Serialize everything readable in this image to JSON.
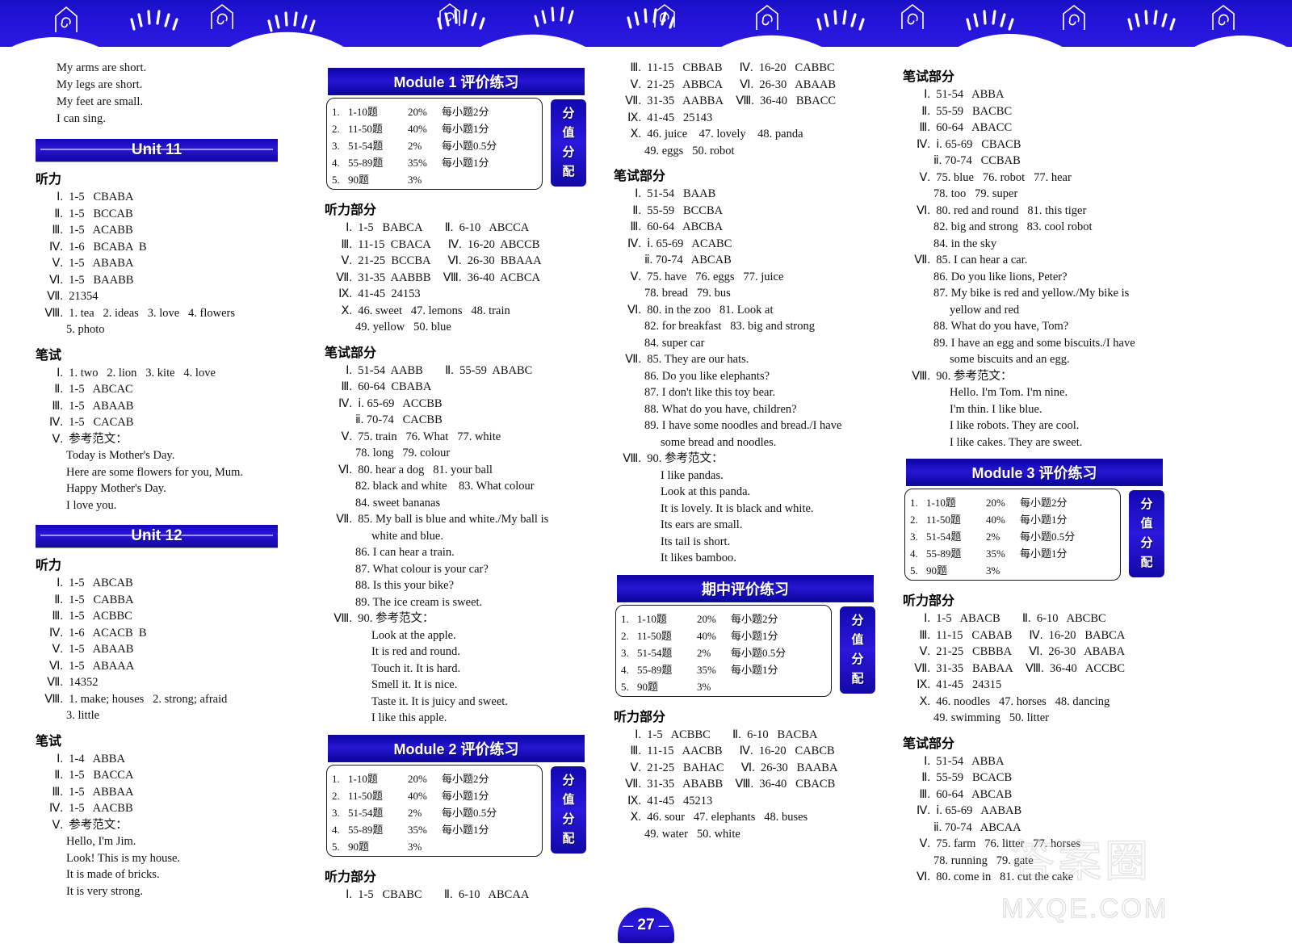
{
  "page": {
    "number": "27",
    "watermark_text": "MXQE.COM",
    "watermark_cn": "答案圈"
  },
  "score_badge_label": "分值分配",
  "score_table": {
    "rows": [
      {
        "n": "1.",
        "q": "1-10题",
        "p": "20%",
        "d": "每小题2分"
      },
      {
        "n": "2.",
        "q": "11-50题",
        "p": "40%",
        "d": "每小题1分"
      },
      {
        "n": "3.",
        "q": "51-54题",
        "p": "2%",
        "d": "每小题0.5分"
      },
      {
        "n": "4.",
        "q": "55-89题",
        "p": "35%",
        "d": "每小题1分"
      },
      {
        "n": "5.",
        "q": "90题",
        "p": "3%",
        "d": ""
      }
    ]
  },
  "headings": {
    "listening": "听力部分",
    "written": "笔试部分",
    "listening_short": "听力",
    "written_short": "笔试",
    "model_essay": "参考范文："
  },
  "column1": {
    "poem": [
      "My arms are short.",
      "My legs are short.",
      "My feet are small.",
      "I can sing."
    ],
    "unit11": {
      "title": "Unit 11",
      "listening": [
        {
          "rn": "Ⅰ.",
          "body": "1-5   CBABA"
        },
        {
          "rn": "Ⅱ.",
          "body": "1-5   BCCAB"
        },
        {
          "rn": "Ⅲ.",
          "body": "1-5   ACABB"
        },
        {
          "rn": "Ⅳ.",
          "body": "1-6   BCABA  B"
        },
        {
          "rn": "Ⅴ.",
          "body": "1-5   ABABA"
        },
        {
          "rn": "Ⅵ.",
          "body": "1-5   BAABB"
        },
        {
          "rn": "Ⅶ.",
          "body": "21354"
        },
        {
          "rn": "Ⅷ.",
          "body": "1. tea   2. ideas   3. love   4. flowers"
        },
        {
          "rn": "",
          "body": "5. photo",
          "indent": 1
        }
      ],
      "written": [
        {
          "rn": "Ⅰ.",
          "body": "1. two   2. lion   3. kite   4. love"
        },
        {
          "rn": "Ⅱ.",
          "body": "1-5   ABCAC"
        },
        {
          "rn": "Ⅲ.",
          "body": "1-5   ABAAB"
        },
        {
          "rn": "Ⅳ.",
          "body": "1-5   CACAB"
        },
        {
          "rn": "Ⅴ.",
          "body": "参考范文："
        },
        {
          "rn": "",
          "body": "Today is Mother's Day.",
          "indent": 1
        },
        {
          "rn": "",
          "body": "Here are some flowers for you, Mum.",
          "indent": 1
        },
        {
          "rn": "",
          "body": "Happy Mother's Day.",
          "indent": 1
        },
        {
          "rn": "",
          "body": "I love you.",
          "indent": 1
        }
      ]
    },
    "unit12": {
      "title": "Unit 12",
      "listening": [
        {
          "rn": "Ⅰ.",
          "body": "1-5   ABCAB"
        },
        {
          "rn": "Ⅱ.",
          "body": "1-5   CABBA"
        },
        {
          "rn": "Ⅲ.",
          "body": "1-5   ACBBC"
        },
        {
          "rn": "Ⅳ.",
          "body": "1-6   ACACB  B"
        },
        {
          "rn": "Ⅴ.",
          "body": "1-5   ABAAB"
        },
        {
          "rn": "Ⅵ.",
          "body": "1-5   ABAAA"
        },
        {
          "rn": "Ⅶ.",
          "body": "14352"
        },
        {
          "rn": "Ⅷ.",
          "body": "1. make; houses   2. strong; afraid"
        },
        {
          "rn": "",
          "body": "3. little",
          "indent": 1
        }
      ],
      "written": [
        {
          "rn": "Ⅰ.",
          "body": "1-4   ABBA"
        },
        {
          "rn": "Ⅱ.",
          "body": "1-5   BACCA"
        },
        {
          "rn": "Ⅲ.",
          "body": "1-5   ABBAA"
        },
        {
          "rn": "Ⅳ.",
          "body": "1-5   AACBB"
        },
        {
          "rn": "Ⅴ.",
          "body": "参考范文："
        },
        {
          "rn": "",
          "body": "Hello, I'm Jim.",
          "indent": 1
        },
        {
          "rn": "",
          "body": "Look! This is my house.",
          "indent": 1
        },
        {
          "rn": "",
          "body": "It is made of bricks.",
          "indent": 1
        },
        {
          "rn": "",
          "body": "It is very strong.",
          "indent": 1
        }
      ]
    }
  },
  "column2": {
    "module1": {
      "title": "Module 1 评价练习",
      "listening": [
        {
          "rn": "Ⅰ.",
          "body": "1-5   BABCA",
          "rn2": "Ⅱ.",
          "body2": "6-10   ABCCA"
        },
        {
          "rn": "Ⅲ.",
          "body": "11-15  CBACA",
          "rn2": "Ⅳ.",
          "body2": "16-20  ABCCB"
        },
        {
          "rn": "Ⅴ.",
          "body": "21-25  BCCBA",
          "rn2": "Ⅵ.",
          "body2": "26-30  BBAAA"
        },
        {
          "rn": "Ⅶ.",
          "body": "31-35  AABBB",
          "rn2": "Ⅷ.",
          "body2": "36-40  ACBCA"
        },
        {
          "rn": "Ⅸ.",
          "body": "41-45  24153"
        },
        {
          "rn": "Ⅹ.",
          "body": "46. sweet   47. lemons   48. train"
        },
        {
          "rn": "",
          "body": "49. yellow   50. blue",
          "indent": 1
        }
      ],
      "written": [
        {
          "rn": "Ⅰ.",
          "body": "51-54  AABB",
          "rn2": "Ⅱ.",
          "body2": "55-59  ABABC"
        },
        {
          "rn": "Ⅲ.",
          "body": "60-64  CBABA"
        },
        {
          "rn": "Ⅳ.",
          "body": "ⅰ. 65-69   ACCBB"
        },
        {
          "rn": "",
          "body": "ⅱ. 70-74   CACBB",
          "indent": 1
        },
        {
          "rn": "Ⅴ.",
          "body": "75. train   76. What   77. white"
        },
        {
          "rn": "",
          "body": "78. long   79. colour",
          "indent": 1
        },
        {
          "rn": "Ⅵ.",
          "body": "80. hear a dog   81. your ball"
        },
        {
          "rn": "",
          "body": "82. black and white    83. What colour",
          "indent": 1
        },
        {
          "rn": "",
          "body": "84. sweet bananas",
          "indent": 1
        },
        {
          "rn": "Ⅶ.",
          "body": "85. My ball is blue and white./My ball is"
        },
        {
          "rn": "",
          "body": "white and blue.",
          "indent": 2
        },
        {
          "rn": "",
          "body": "86. I can hear a train.",
          "indent": 1
        },
        {
          "rn": "",
          "body": "87. What colour is your car?",
          "indent": 1
        },
        {
          "rn": "",
          "body": "88. Is this your bike?",
          "indent": 1
        },
        {
          "rn": "",
          "body": "89. The ice cream is sweet.",
          "indent": 1
        },
        {
          "rn": "Ⅷ.",
          "body": "90. 参考范文："
        },
        {
          "rn": "",
          "body": "Look at the apple.",
          "indent": 2
        },
        {
          "rn": "",
          "body": "It is red and round.",
          "indent": 2
        },
        {
          "rn": "",
          "body": "Touch it. It is hard.",
          "indent": 2
        },
        {
          "rn": "",
          "body": "Smell it. It is nice.",
          "indent": 2
        },
        {
          "rn": "",
          "body": "Taste it. It is juicy and sweet.",
          "indent": 2
        },
        {
          "rn": "",
          "body": "I like this apple.",
          "indent": 2
        }
      ]
    },
    "module2": {
      "title": "Module 2 评价练习",
      "listening": [
        {
          "rn": "Ⅰ.",
          "body": "1-5   CBABC",
          "rn2": "Ⅱ.",
          "body2": "6-10   ABCAA"
        }
      ]
    }
  },
  "column3": {
    "module2_cont": {
      "listening": [
        {
          "rn": "Ⅲ.",
          "body": "11-15   CBBAB",
          "rn2": "Ⅳ.",
          "body2": "16-20   CABBC"
        },
        {
          "rn": "Ⅴ.",
          "body": "21-25   ABBCA",
          "rn2": "Ⅵ.",
          "body2": "26-30   ABAAB"
        },
        {
          "rn": "Ⅶ.",
          "body": "31-35   AABBA",
          "rn2": "Ⅷ.",
          "body2": "36-40   BBACC"
        },
        {
          "rn": "Ⅸ.",
          "body": "41-45   25143"
        },
        {
          "rn": "Ⅹ.",
          "body": "46. juice    47. lovely    48. panda"
        },
        {
          "rn": "",
          "body": "49. eggs   50. robot",
          "indent": 1
        }
      ],
      "written": [
        {
          "rn": "Ⅰ.",
          "body": "51-54   BAAB"
        },
        {
          "rn": "Ⅱ.",
          "body": "55-59   BCCBA"
        },
        {
          "rn": "Ⅲ.",
          "body": "60-64   ABCBA"
        },
        {
          "rn": "Ⅳ.",
          "body": "ⅰ. 65-69   ACABC"
        },
        {
          "rn": "",
          "body": "ⅱ. 70-74   ABCAB",
          "indent": 1
        },
        {
          "rn": "Ⅴ.",
          "body": "75. have   76. eggs   77. juice"
        },
        {
          "rn": "",
          "body": "78. bread   79. bus",
          "indent": 1
        },
        {
          "rn": "Ⅵ.",
          "body": "80. in the zoo   81. Look at"
        },
        {
          "rn": "",
          "body": "82. for breakfast   83. big and strong",
          "indent": 1
        },
        {
          "rn": "",
          "body": "84. super car",
          "indent": 1
        },
        {
          "rn": "Ⅶ.",
          "body": "85. They are our hats."
        },
        {
          "rn": "",
          "body": "86. Do you like elephants?",
          "indent": 1
        },
        {
          "rn": "",
          "body": "87. I don't like this toy bear.",
          "indent": 1
        },
        {
          "rn": "",
          "body": "88. What do you have, children?",
          "indent": 1
        },
        {
          "rn": "",
          "body": "89. I have some noodles and bread./I have",
          "indent": 1
        },
        {
          "rn": "",
          "body": "some bread and noodles.",
          "indent": 2
        },
        {
          "rn": "Ⅷ.",
          "body": "90. 参考范文："
        },
        {
          "rn": "",
          "body": "I like pandas.",
          "indent": 2
        },
        {
          "rn": "",
          "body": "Look at this panda.",
          "indent": 2
        },
        {
          "rn": "",
          "body": "It is lovely. It is black and white.",
          "indent": 2
        },
        {
          "rn": "",
          "body": "Its ears are small.",
          "indent": 2
        },
        {
          "rn": "",
          "body": "Its tail is short.",
          "indent": 2
        },
        {
          "rn": "",
          "body": "It likes bamboo.",
          "indent": 2
        }
      ]
    },
    "midterm": {
      "title": "期中评价练习",
      "listening": [
        {
          "rn": "Ⅰ.",
          "body": "1-5   ACBBC",
          "rn2": "Ⅱ.",
          "body2": "6-10   BACBA"
        },
        {
          "rn": "Ⅲ.",
          "body": "11-15   AACBB",
          "rn2": "Ⅳ.",
          "body2": "16-20   CABCB"
        },
        {
          "rn": "Ⅴ.",
          "body": "21-25   BAHAC",
          "rn2": "Ⅵ.",
          "body2": "26-30   BAABA"
        },
        {
          "rn": "Ⅶ.",
          "body": "31-35   ABABB",
          "rn2": "Ⅷ.",
          "body2": "36-40   CBACB"
        },
        {
          "rn": "Ⅸ.",
          "body": "41-45   45213"
        },
        {
          "rn": "Ⅹ.",
          "body": "46. sour   47. elephants   48. buses"
        },
        {
          "rn": "",
          "body": "49. water   50. white",
          "indent": 1
        }
      ]
    }
  },
  "column4": {
    "midterm_written": {
      "written": [
        {
          "rn": "Ⅰ.",
          "body": "51-54   ABBA"
        },
        {
          "rn": "Ⅱ.",
          "body": "55-59   BACBC"
        },
        {
          "rn": "Ⅲ.",
          "body": "60-64   ABACC"
        },
        {
          "rn": "Ⅳ.",
          "body": "ⅰ. 65-69   CBACB"
        },
        {
          "rn": "",
          "body": "ⅱ. 70-74   CCBAB",
          "indent": 1
        },
        {
          "rn": "Ⅴ.",
          "body": "75. blue   76. robot   77. hear"
        },
        {
          "rn": "",
          "body": "78. too   79. super",
          "indent": 1
        },
        {
          "rn": "Ⅵ.",
          "body": "80. red and round   81. this tiger"
        },
        {
          "rn": "",
          "body": "82. big and strong   83. cool robot",
          "indent": 1
        },
        {
          "rn": "",
          "body": "84. in the sky",
          "indent": 1
        },
        {
          "rn": "Ⅶ.",
          "body": "85. I can hear a car."
        },
        {
          "rn": "",
          "body": "86. Do you like lions, Peter?",
          "indent": 1
        },
        {
          "rn": "",
          "body": "87. My bike is red and yellow./My bike is",
          "indent": 1
        },
        {
          "rn": "",
          "body": "yellow and red",
          "indent": 2
        },
        {
          "rn": "",
          "body": "88. What do you have, Tom?",
          "indent": 1
        },
        {
          "rn": "",
          "body": "89. I have an egg and some biscuits./I have",
          "indent": 1
        },
        {
          "rn": "",
          "body": "some biscuits and an egg.",
          "indent": 2
        },
        {
          "rn": "Ⅷ.",
          "body": "90. 参考范文："
        },
        {
          "rn": "",
          "body": "Hello. I'm Tom. I'm nine.",
          "indent": 2
        },
        {
          "rn": "",
          "body": "I'm thin. I like blue.",
          "indent": 2
        },
        {
          "rn": "",
          "body": "I like robots. They are cool.",
          "indent": 2
        },
        {
          "rn": "",
          "body": "I like cakes. They are sweet.",
          "indent": 2
        }
      ]
    },
    "module3": {
      "title": "Module 3 评价练习",
      "listening": [
        {
          "rn": "Ⅰ.",
          "body": "1-5   ABACB",
          "rn2": "Ⅱ.",
          "body2": "6-10   ABCBC"
        },
        {
          "rn": "Ⅲ.",
          "body": "11-15   CABAB",
          "rn2": "Ⅳ.",
          "body2": "16-20   BABCA"
        },
        {
          "rn": "Ⅴ.",
          "body": "21-25   CBBBA",
          "rn2": "Ⅵ.",
          "body2": "26-30   ABABA"
        },
        {
          "rn": "Ⅶ.",
          "body": "31-35   BABAA",
          "rn2": "Ⅷ.",
          "body2": "36-40   ACCBC"
        },
        {
          "rn": "Ⅸ.",
          "body": "41-45   24315"
        },
        {
          "rn": "Ⅹ.",
          "body": "46. noodles   47. horses   48. dancing"
        },
        {
          "rn": "",
          "body": "49. swimming   50. litter",
          "indent": 1
        }
      ],
      "written": [
        {
          "rn": "Ⅰ.",
          "body": "51-54   ABBA"
        },
        {
          "rn": "Ⅱ.",
          "body": "55-59   BCACB"
        },
        {
          "rn": "Ⅲ.",
          "body": "60-64   ABCAB"
        },
        {
          "rn": "Ⅳ.",
          "body": "ⅰ. 65-69   AABAB"
        },
        {
          "rn": "",
          "body": "ⅱ. 70-74   ABCAA",
          "indent": 1
        },
        {
          "rn": "Ⅴ.",
          "body": "75. farm   76. litter   77. horses"
        },
        {
          "rn": "",
          "body": "78. running   79. gate",
          "indent": 1
        },
        {
          "rn": "Ⅵ.",
          "body": "80. come in   81. cut the cake"
        }
      ]
    }
  }
}
